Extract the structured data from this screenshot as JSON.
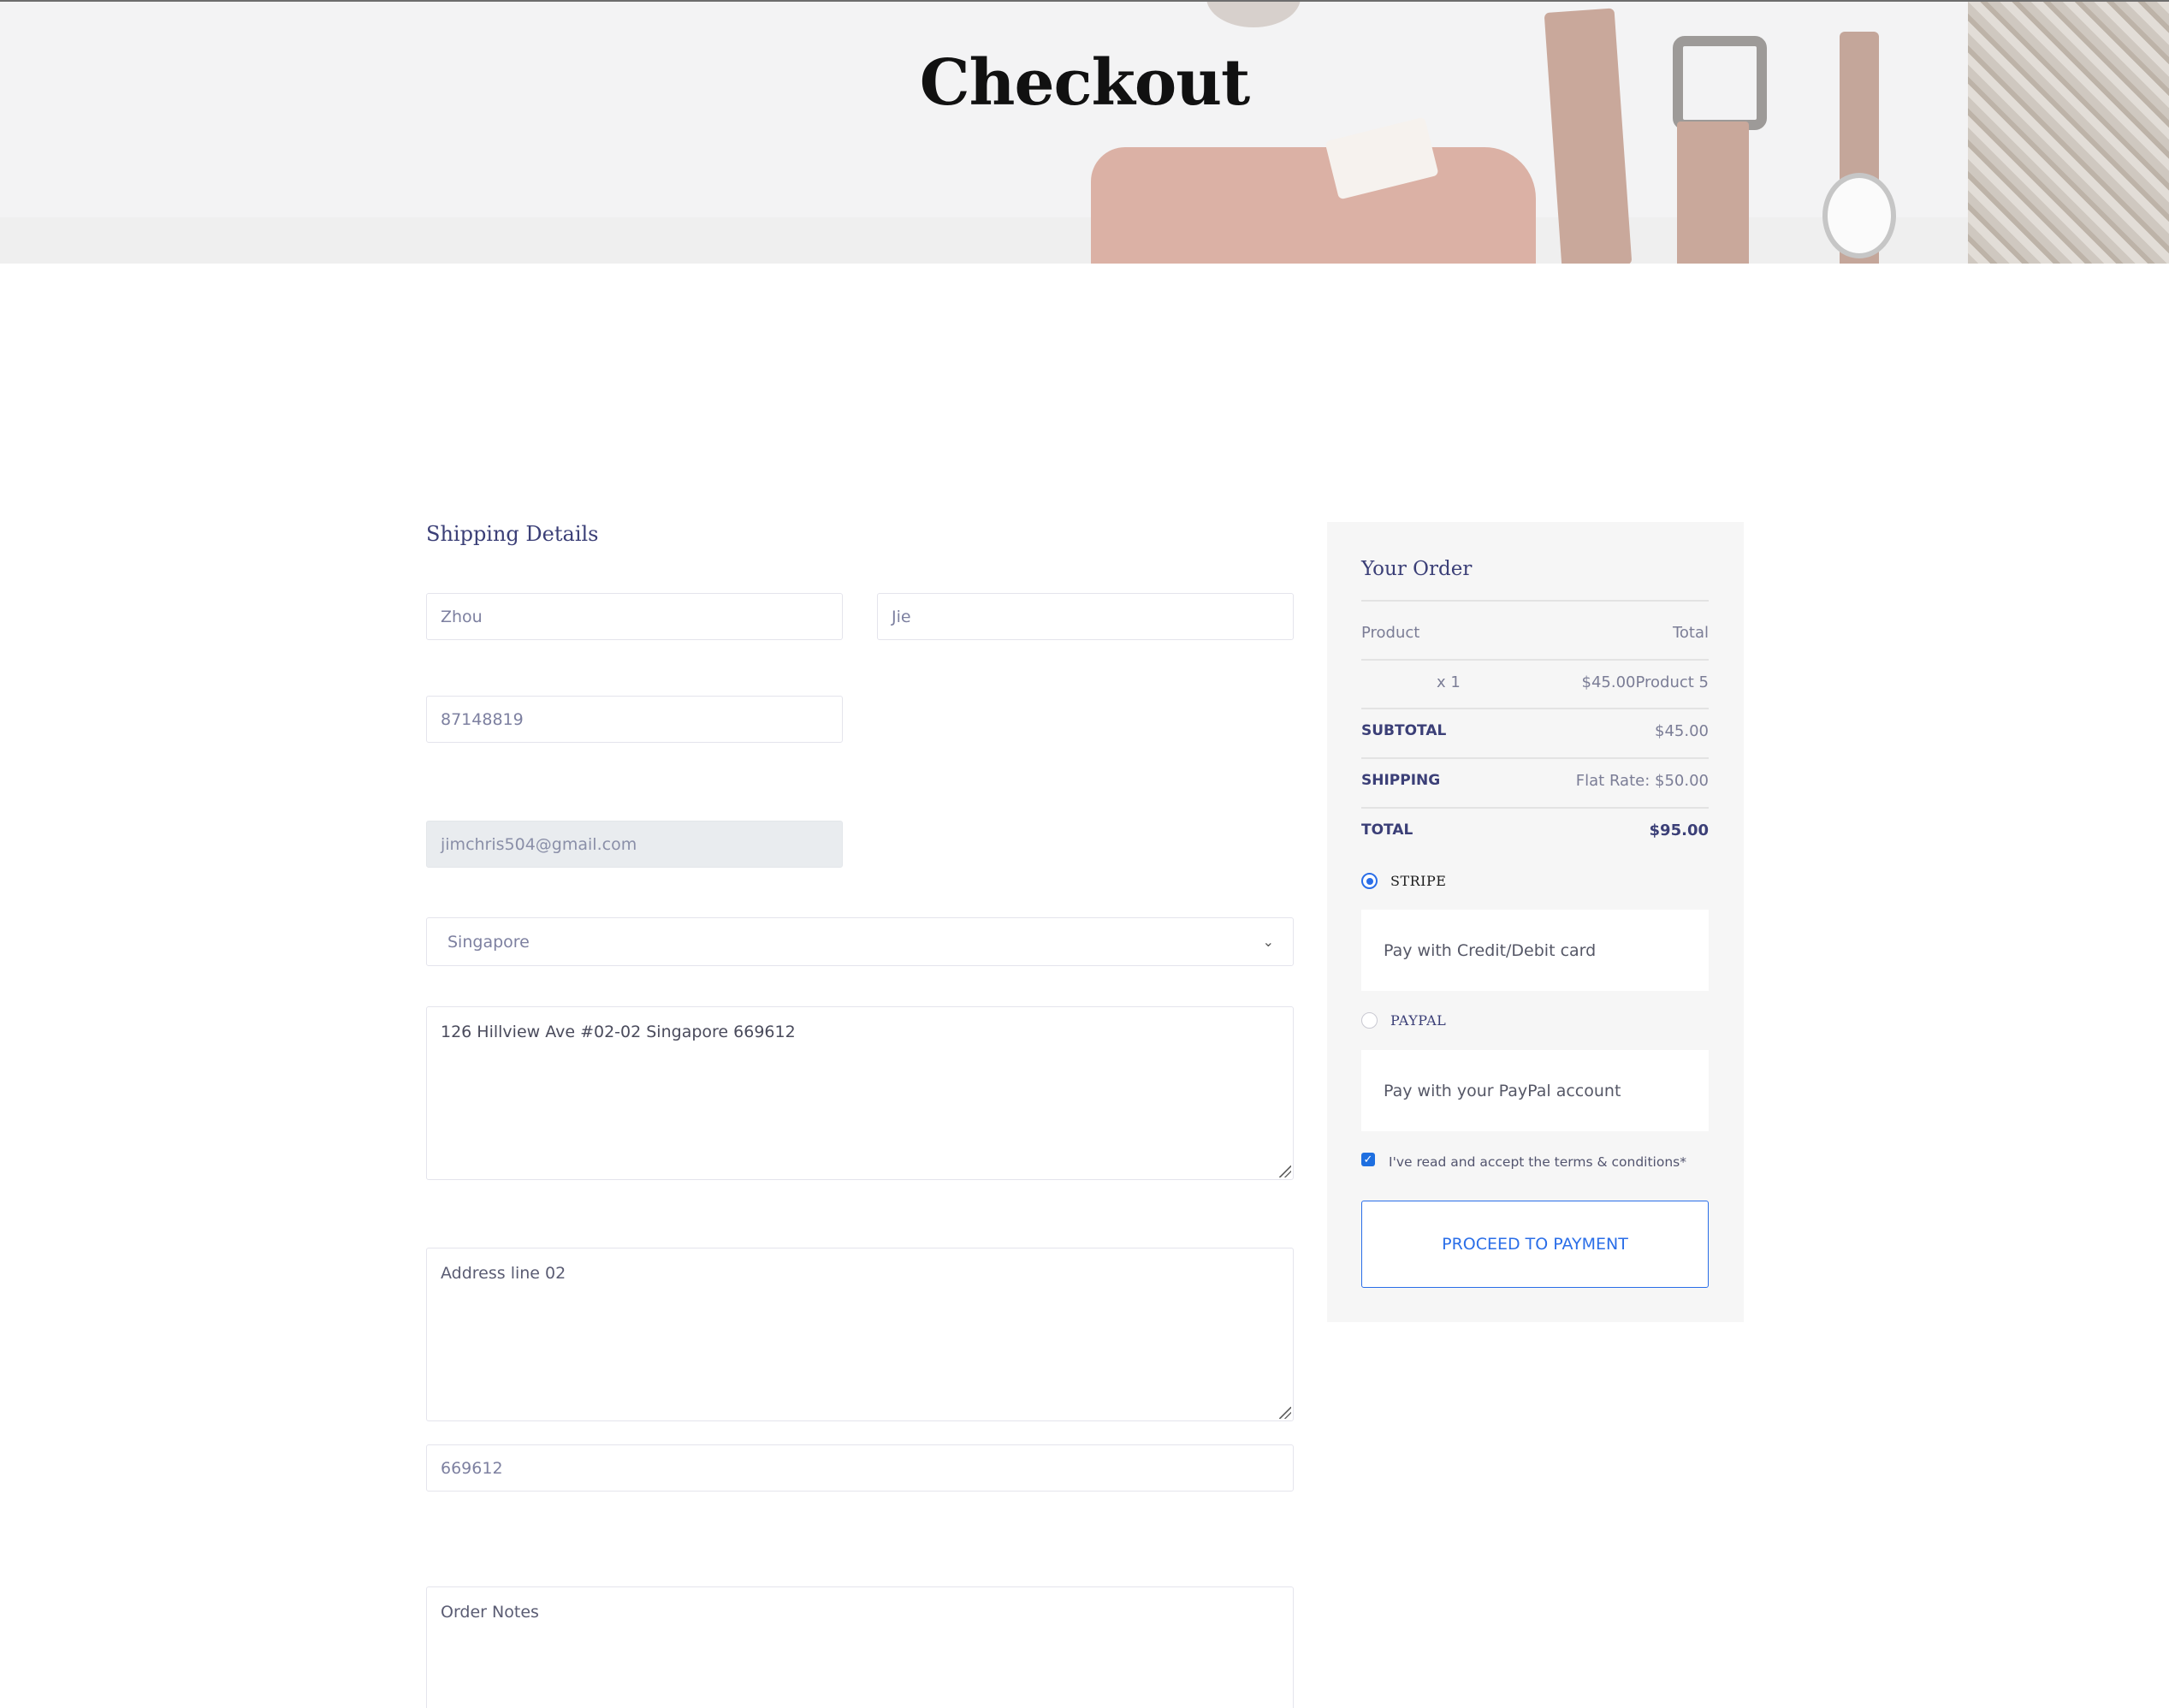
{
  "page": {
    "title": "Checkout"
  },
  "shipping": {
    "heading": "Shipping Details",
    "first_name": "Zhou",
    "last_name": "Jie",
    "phone": "87148819",
    "email": "jimchris504@gmail.com",
    "country": "Singapore",
    "address_line_1": "126 Hillview Ave #02-02 Singapore 669612",
    "address_line_2_placeholder": "Address line 02",
    "postal_code": "669612",
    "order_notes_placeholder": "Order Notes"
  },
  "order": {
    "heading": "Your Order",
    "columns": {
      "product": "Product",
      "total": "Total"
    },
    "item": {
      "qty": "x 1",
      "price_name": "$45.00Product 5"
    },
    "subtotal": {
      "label": "SUBTOTAL",
      "value": "$45.00"
    },
    "shipping": {
      "label": "SHIPPING",
      "value": "Flat Rate: $50.00"
    },
    "total": {
      "label": "TOTAL",
      "value": "$95.00"
    },
    "payment": {
      "stripe": {
        "label": "STRIPE",
        "description": "Pay with Credit/Debit card",
        "selected": true
      },
      "paypal": {
        "label": "PAYPAL",
        "description": "Pay with your PayPal account",
        "selected": false
      }
    },
    "terms": "I've read and accept the terms & conditions*",
    "terms_checked": true,
    "proceed_label": "PROCEED TO PAYMENT"
  },
  "colors": {
    "accent": "#2a6ee8",
    "heading": "#3b3f77"
  }
}
